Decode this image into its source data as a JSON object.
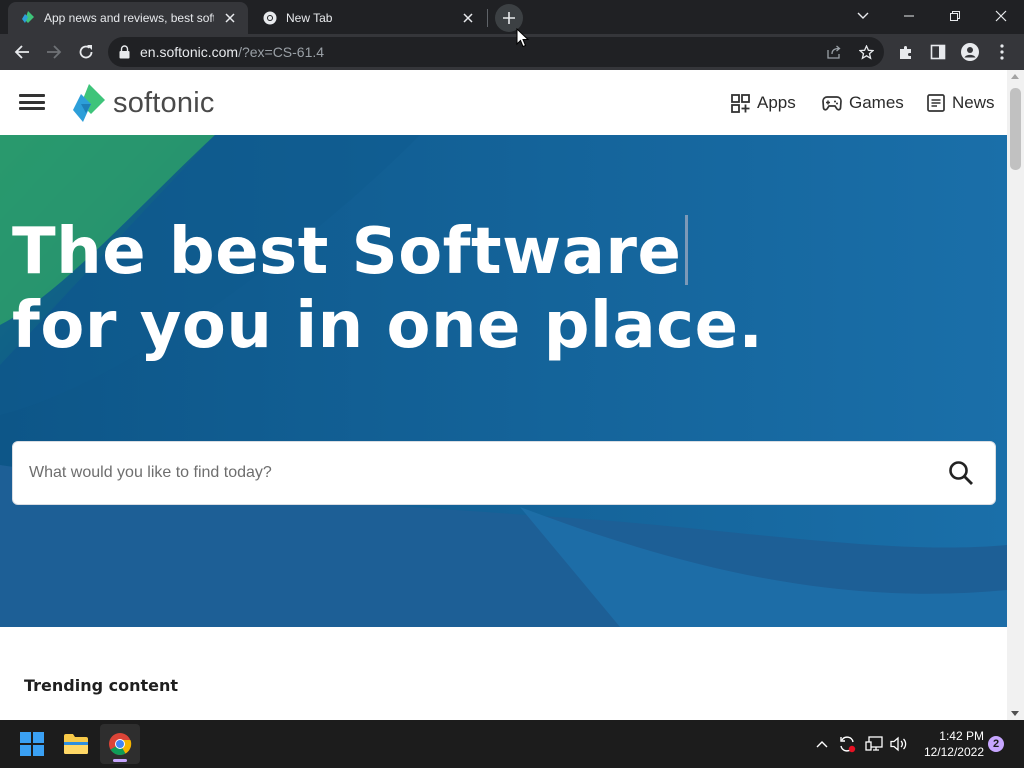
{
  "browser": {
    "tabs": [
      {
        "title": "App news and reviews, best softw",
        "favicon": "softonic-logo-icon",
        "active": true
      },
      {
        "title": "New Tab",
        "favicon": "chrome-icon",
        "active": false
      }
    ],
    "url": {
      "host": "en.softonic.com",
      "path": "/?ex=CS-61.4"
    }
  },
  "site": {
    "logo_text": "softonic",
    "nav": [
      {
        "label": "Apps",
        "icon": "apps-grid-icon"
      },
      {
        "label": "Games",
        "icon": "gamepad-icon"
      },
      {
        "label": "News",
        "icon": "newspaper-icon"
      }
    ],
    "hero": {
      "title_line1": "The best Software",
      "title_line2": "for you in one place."
    },
    "search": {
      "placeholder": "What would you like to find today?"
    },
    "trending_heading": "Trending content"
  },
  "taskbar": {
    "time": "1:42 PM",
    "date": "12/12/2022",
    "notification_count": "2"
  },
  "colors": {
    "brand_green": "#3ec47a",
    "brand_blue": "#2d9fd9",
    "hero_blue": "#1767a0",
    "hero_dark": "#0f4a78"
  }
}
